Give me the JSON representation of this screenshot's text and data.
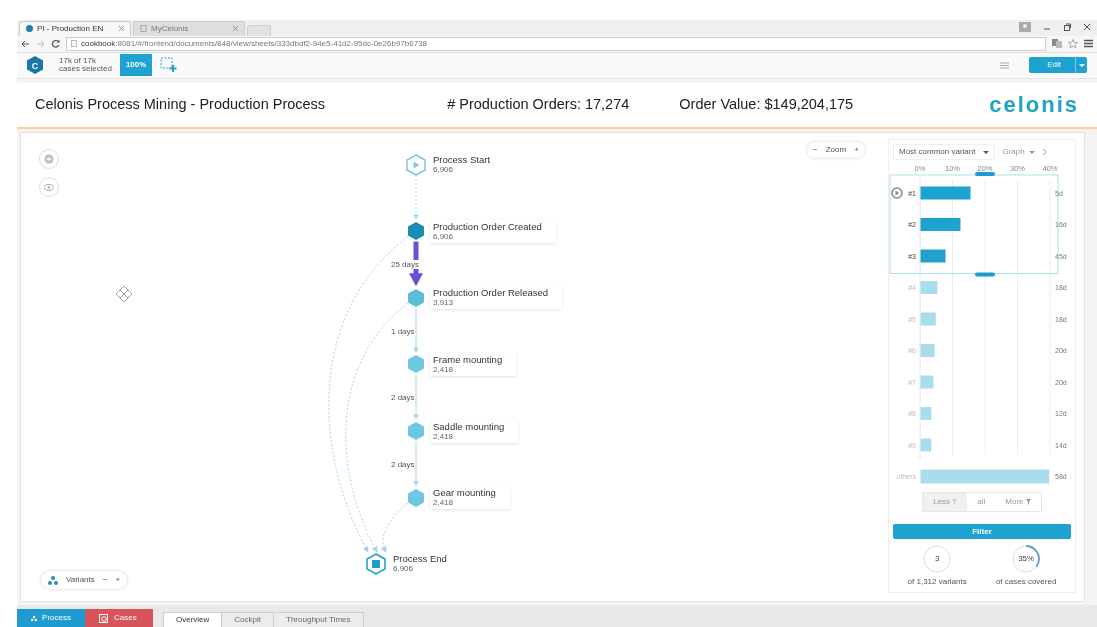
{
  "browser": {
    "tabs": [
      {
        "title": "PI - Production EN",
        "selected": true
      },
      {
        "title": "MyCelonis",
        "selected": false
      }
    ],
    "url_host": "cookbook",
    "url_path": ":8081/#/frontend/documents/848/view/sheets/333dbdf2-94e5-41d2-95dc-0e26b97b6738"
  },
  "toolbar": {
    "logo_letter": "C",
    "selection_count": "17k of 17k",
    "selection_caption": "cases selected",
    "selection_percent": "100%",
    "edit_button": "Edit"
  },
  "header": {
    "title": "Celonis Process Mining - Production Process",
    "production_orders": "# Production Orders: 17,274",
    "order_value": "Order Value: $149,204,175",
    "logo": "celonis"
  },
  "zoom_control": {
    "minus": "−",
    "label": "Zoom",
    "plus": "+"
  },
  "variants_control": {
    "label": "Variants",
    "minus": "−",
    "plus": "+"
  },
  "process_graph": {
    "nodes": [
      {
        "kind": "start",
        "label": "Process Start",
        "count": "6,906",
        "color": "#7cc8e0",
        "to_end": false
      },
      {
        "kind": "activity",
        "label": "Production Order Created",
        "count": "6,906",
        "color": "#1b8db3",
        "to_end": true,
        "edge_in": {
          "highlighted": false,
          "dashed": true
        }
      },
      {
        "kind": "activity",
        "label": "Production Order Released",
        "count": "3,913",
        "color": "#5bbfda",
        "to_end": true,
        "edge_in": {
          "label": "25 days",
          "highlighted": true,
          "dashed": false
        }
      },
      {
        "kind": "activity",
        "label": "Frame mounting",
        "count": "2,418",
        "color": "#6cc8e0",
        "to_end": false,
        "edge_in": {
          "label": "1 days",
          "highlighted": false,
          "dashed": false
        }
      },
      {
        "kind": "activity",
        "label": "Saddle mounting",
        "count": "2,418",
        "color": "#6cc8e0",
        "to_end": false,
        "edge_in": {
          "label": "2 days",
          "highlighted": false,
          "dashed": false
        }
      },
      {
        "kind": "activity",
        "label": "Gear mounting",
        "count": "2,418",
        "color": "#6cc8e0",
        "to_end": true,
        "edge_in": {
          "label": "2 days",
          "highlighted": false,
          "dashed": false
        }
      },
      {
        "kind": "end",
        "label": "Process End",
        "count": "6,906",
        "color": "#1b9fc4"
      }
    ]
  },
  "variant_panel": {
    "dropdown": "Most common variant",
    "view_dropdown": "Graph",
    "chart_data": {
      "type": "bar",
      "orientation": "horizontal",
      "grid": true,
      "categories": [
        "#1",
        "#2",
        "#3",
        "#4",
        "#5",
        "#6",
        "#7",
        "#8",
        "#9",
        "others"
      ],
      "values": [
        15.4,
        12.3,
        7.7,
        5.2,
        4.7,
        4.3,
        4.0,
        3.3,
        3.3,
        39.6
      ],
      "xlim": [
        0,
        40
      ],
      "xticks": [
        {
          "value": 0,
          "label": "0%"
        },
        {
          "value": 10,
          "label": "10%"
        },
        {
          "value": 20,
          "label": "20%"
        },
        {
          "value": 30,
          "label": "30%"
        },
        {
          "value": 40,
          "label": "40%"
        }
      ]
    },
    "rows": [
      {
        "selected": true,
        "duration": "5d"
      },
      {
        "selected": true,
        "duration": "16d"
      },
      {
        "selected": true,
        "duration": "45d"
      },
      {
        "selected": false,
        "duration": "18d"
      },
      {
        "selected": false,
        "duration": "18d"
      },
      {
        "selected": false,
        "duration": "20d"
      },
      {
        "selected": false,
        "duration": "20d"
      },
      {
        "selected": false,
        "duration": "12d"
      },
      {
        "selected": false,
        "duration": "14d"
      },
      {
        "selected": false,
        "duration": "58d"
      }
    ],
    "less_button": "Less",
    "all_button": "all",
    "more_button": "More",
    "filter_button": "Filter",
    "variant_count": "3",
    "variant_count_caption": "of 1,312 variants",
    "coverage": "35%",
    "coverage_caption": "of cases covered",
    "coverage_meter": {
      "level": 0.35
    }
  },
  "bottom_tabs": {
    "apps": [
      {
        "label": "Process",
        "color": "#1e9bd0"
      },
      {
        "label": "Cases",
        "color": "#d9535a"
      }
    ],
    "sheets": [
      {
        "label": "Overview",
        "selected": true
      },
      {
        "label": "Cockpit",
        "selected": false
      },
      {
        "label": "Throughput Times",
        "selected": false
      }
    ]
  }
}
